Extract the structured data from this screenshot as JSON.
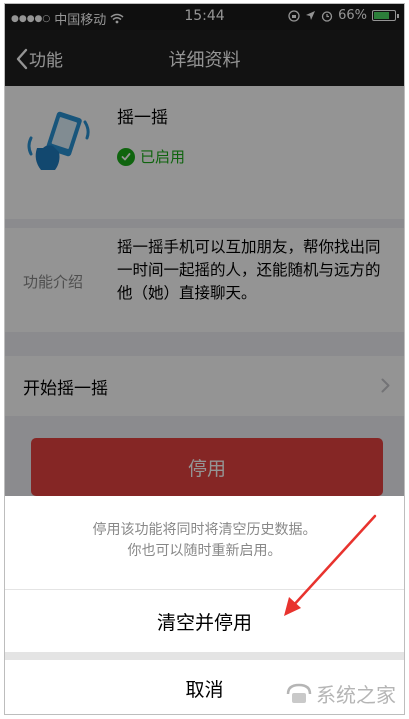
{
  "status_bar": {
    "carrier": "中国移动",
    "time": "15:44",
    "battery": "66%",
    "battery_level": 0.66
  },
  "nav": {
    "back_label": "功能",
    "title": "详细资料"
  },
  "app": {
    "name": "摇一摇",
    "status": "已启用",
    "icon": "shake-phone-icon"
  },
  "intro": {
    "label": "功能介绍",
    "text": "摇一摇手机可以互加朋友，帮你找出同一时间一起摇的人，还能随机与远方的他（她）直接聊天。"
  },
  "row": {
    "label": "开始摇一摇"
  },
  "disable_button": {
    "label": "停用"
  },
  "sheet": {
    "message_line1": "停用该功能将同时将清空历史数据。",
    "message_line2": "你也可以随时重新启用。",
    "confirm_label": "清空并停用",
    "cancel_label": "取消"
  },
  "watermark": {
    "text": "系统之家"
  },
  "colors": {
    "accent_green": "#1aad19",
    "danger_red": "#e64340",
    "nav_bg": "#202020",
    "annotation_arrow": "#e8332e"
  }
}
